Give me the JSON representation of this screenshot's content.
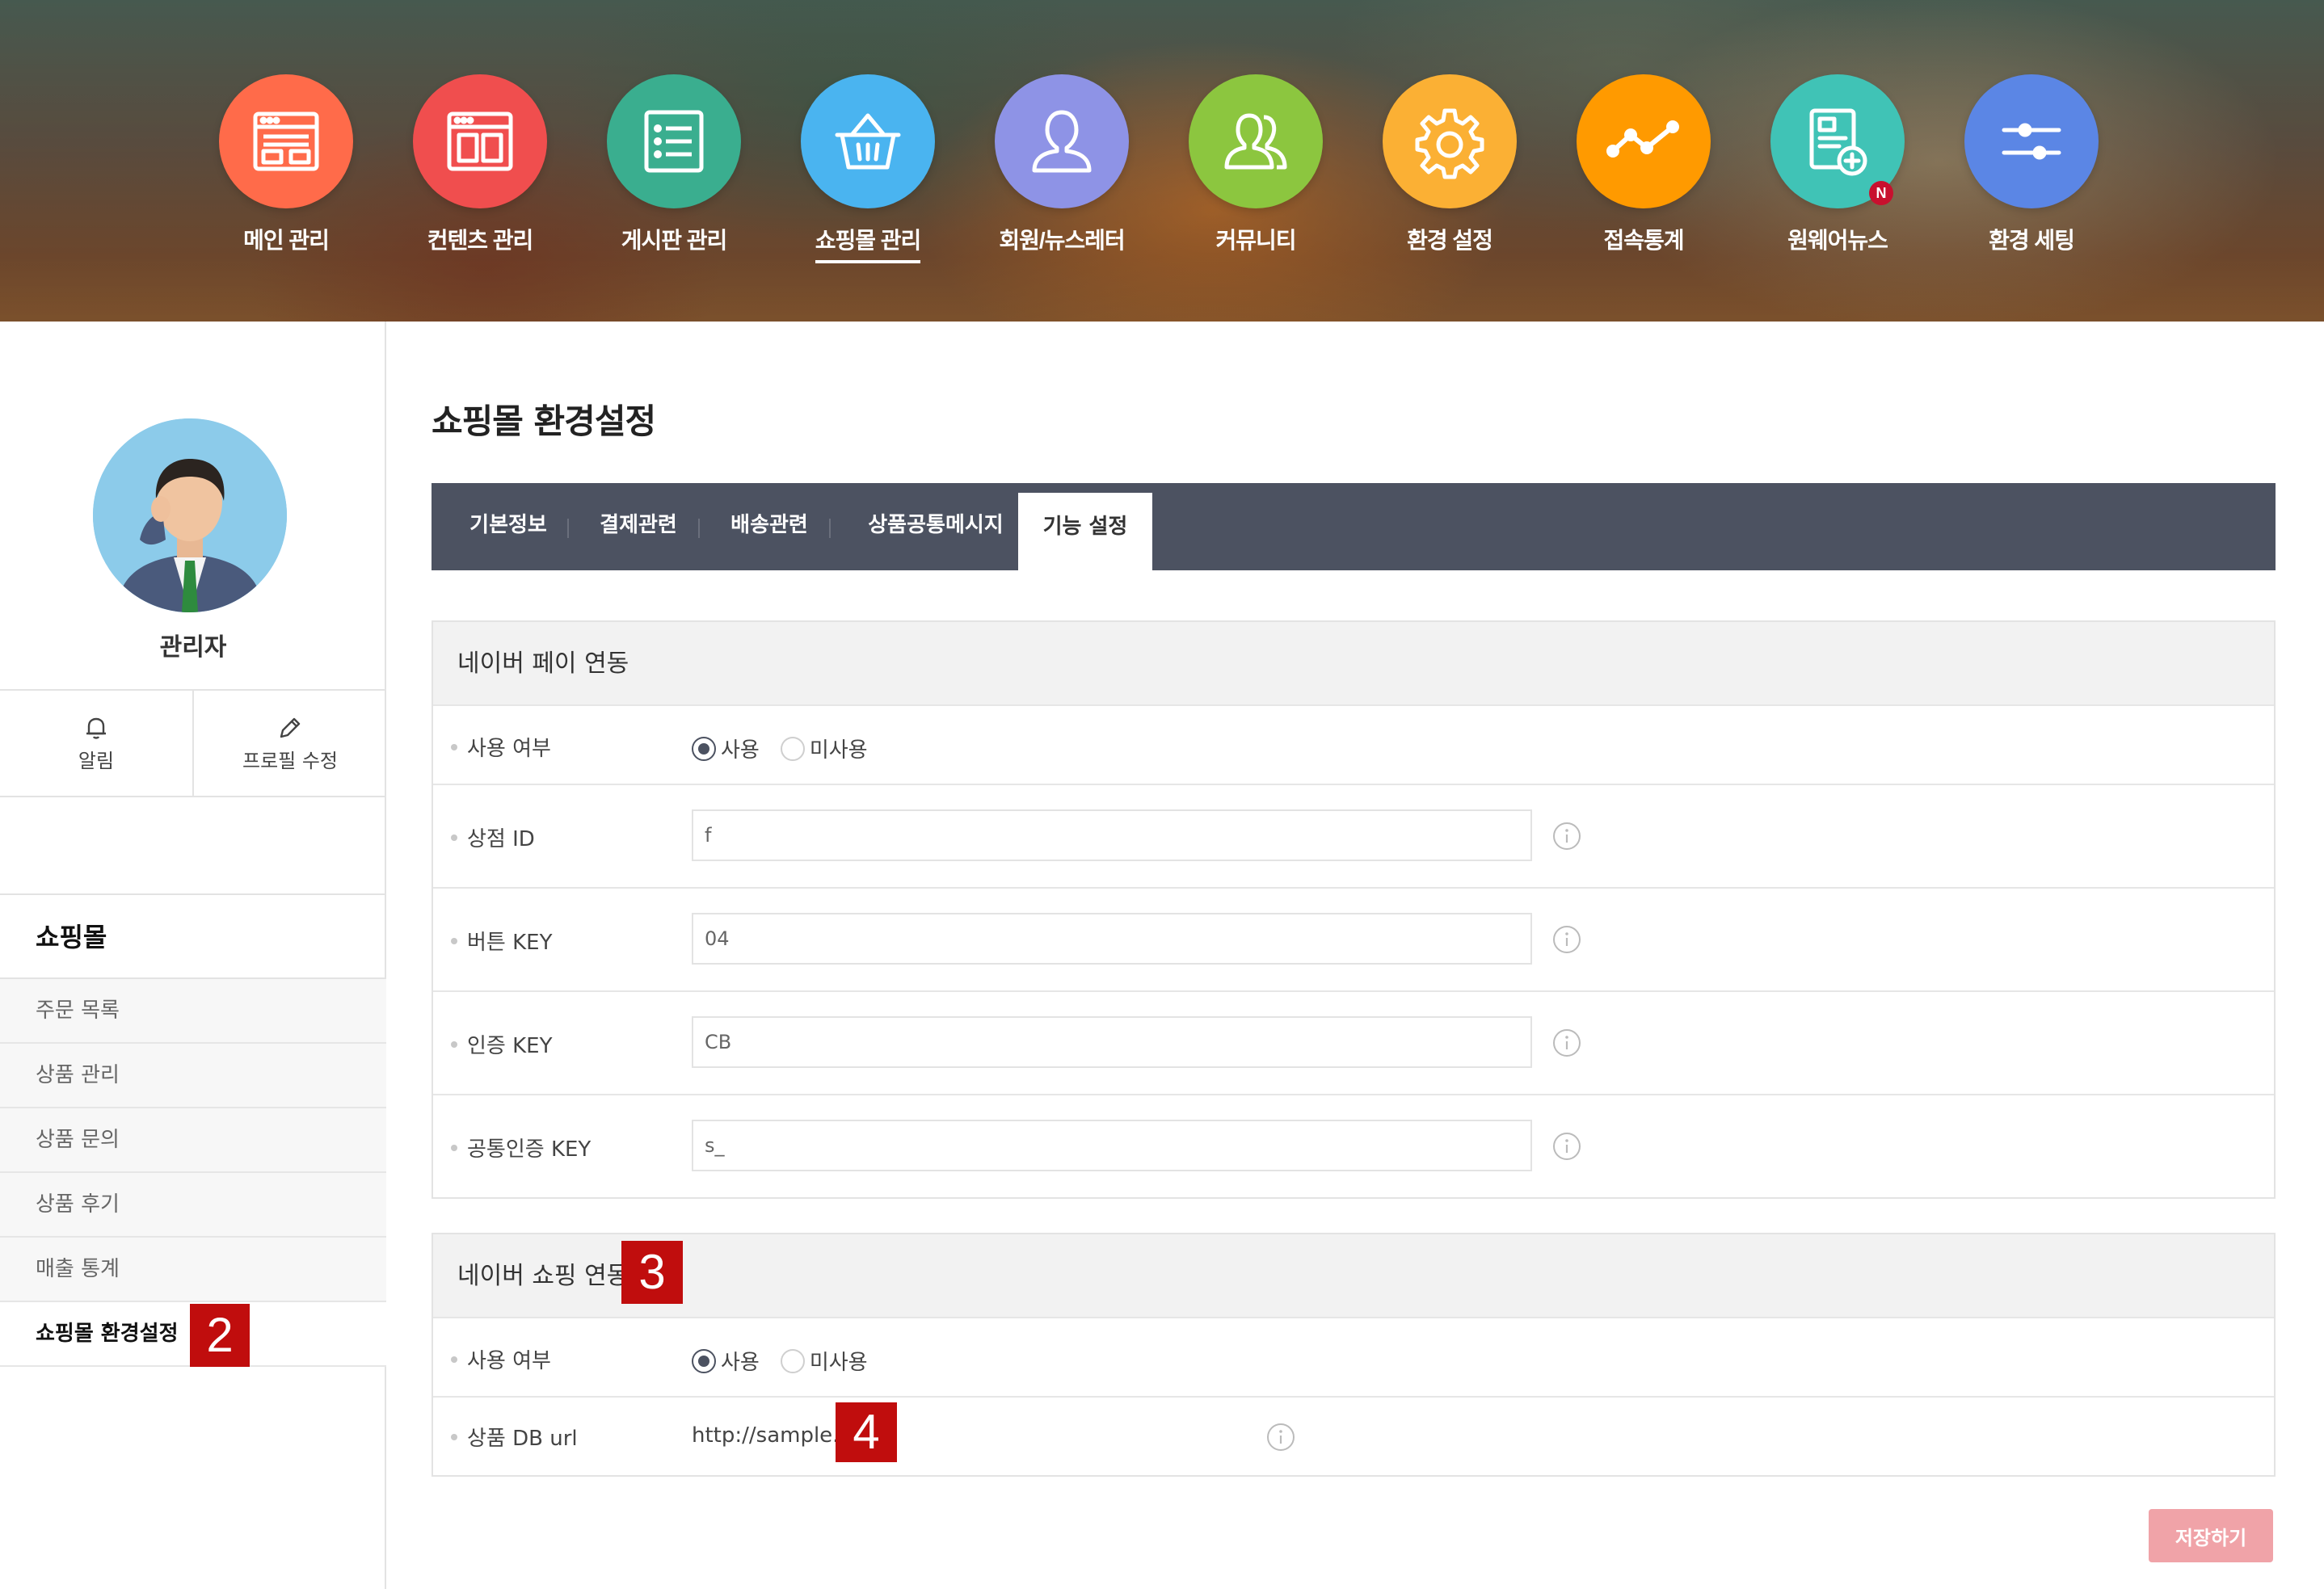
{
  "nav": {
    "items": [
      {
        "label": "메인 관리",
        "icon": "layout-icon",
        "color": "#ff6b4a"
      },
      {
        "label": "컨텐츠 관리",
        "icon": "browser-window-icon",
        "color": "#f04e4e"
      },
      {
        "label": "게시판 관리",
        "icon": "list-icon",
        "color": "#3aae8f"
      },
      {
        "label": "쇼핑몰 관리",
        "icon": "shopping-basket-icon",
        "color": "#4ab4f0"
      },
      {
        "label": "회원/뉴스레터",
        "icon": "user-icon",
        "color": "#8e93e6"
      },
      {
        "label": "커뮤니티",
        "icon": "users-icon",
        "color": "#8cc63f"
      },
      {
        "label": "환경 설정",
        "icon": "gear-icon",
        "color": "#fbb034"
      },
      {
        "label": "접속통계",
        "icon": "line-chart-icon",
        "color": "#ff9a00"
      },
      {
        "label": "원웨어뉴스",
        "icon": "news-add-icon",
        "color": "#40c3b6",
        "badge": "N"
      },
      {
        "label": "환경 세팅",
        "icon": "sliders-icon",
        "color": "#5b86e5"
      }
    ],
    "active": "쇼핑몰 관리"
  },
  "profile": {
    "name": "관리자",
    "actions": [
      {
        "label": "알림",
        "icon": "bell-icon"
      },
      {
        "label": "프로필 수정",
        "icon": "pencil-icon"
      }
    ]
  },
  "sidebar": {
    "title": "쇼핑몰",
    "items": [
      {
        "label": "주문 목록"
      },
      {
        "label": "상품 관리"
      },
      {
        "label": "상품 문의"
      },
      {
        "label": "상품 후기"
      },
      {
        "label": "매출 통계"
      },
      {
        "label": "쇼핑몰 환경설정",
        "active": true
      }
    ]
  },
  "page": {
    "title": "쇼핑몰 환경설정",
    "tabs": [
      "기본정보",
      "결제관련",
      "배송관련",
      "상품공통메시지",
      "기능 설정"
    ],
    "active_tab": "기능 설정"
  },
  "naver_pay": {
    "title": "네이버 페이 연동",
    "use_label": "사용 여부",
    "options": [
      "사용",
      "미사용"
    ],
    "selected": "사용",
    "fields": [
      {
        "label": "상점 ID",
        "value": "f"
      },
      {
        "label": "버튼 KEY",
        "value": "04"
      },
      {
        "label": "인증 KEY",
        "value": "CB"
      },
      {
        "label": "공통인증 KEY",
        "value": "s_"
      }
    ]
  },
  "naver_shopping": {
    "title": "네이버 쇼핑 연동",
    "use_label": "사용 여부",
    "options": [
      "사용",
      "미사용"
    ],
    "selected": "사용",
    "db_url_label": "상품 DB url",
    "db_url_value": "http://sample."
  },
  "annotations": {
    "sidebar_marker": "2",
    "shopping_title_marker": "3",
    "db_url_marker": "4"
  },
  "save_label": "저장하기",
  "colors": {
    "tab_bar": "#4c5261",
    "save_button": "#f0a3a8",
    "marker_red": "#c00d0d"
  }
}
